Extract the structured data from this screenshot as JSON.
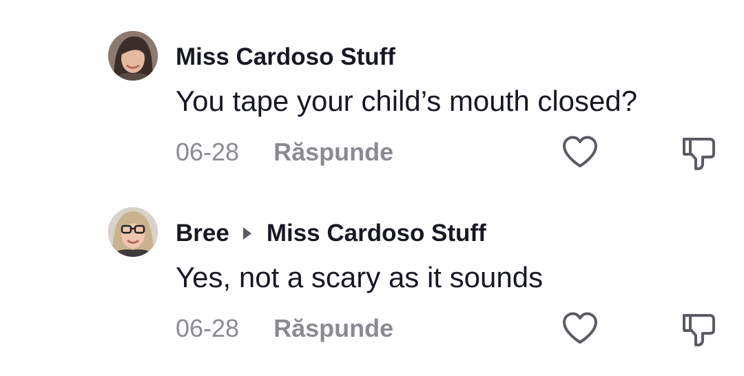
{
  "comments": [
    {
      "author": "Miss Cardoso Stuff",
      "text": "You tape your child’s mouth closed?",
      "date": "06-28",
      "reply_label": "Răspunde",
      "avatar_icon": "woman-avatar"
    },
    {
      "author": "Bree",
      "reply_to": "Miss Cardoso Stuff",
      "text": "Yes, not a scary as it sounds",
      "date": "06-28",
      "reply_label": "Răspunde",
      "avatar_icon": "woman-glasses-avatar"
    }
  ],
  "icons": {
    "like": "heart-icon",
    "dislike": "thumbs-down-icon",
    "reply_to_arrow": "triangle-right-icon"
  },
  "colors": {
    "text_primary": "#161823",
    "text_secondary": "#8a8b91",
    "icon_stroke": "#5a5b63",
    "background": "#ffffff"
  }
}
